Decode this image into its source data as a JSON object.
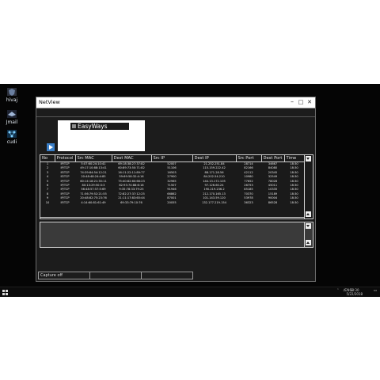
{
  "desktop": {
    "icons": [
      {
        "label": "hivaj",
        "icon": "shield-app-icon"
      },
      {
        "label": "Jmail",
        "icon": "hat-app-icon"
      },
      {
        "label": "cudi",
        "icon": "network-app-icon"
      }
    ]
  },
  "window": {
    "title": "NetView",
    "buttons": {
      "minimize": "–",
      "maximize": "□",
      "close": "✕"
    }
  },
  "logo": {
    "text": "EasyWays"
  },
  "table": {
    "columns": [
      "No",
      "Protocol",
      "Src MAC",
      "Dest MAC",
      "Src IP",
      "Dest IP",
      "Src Port",
      "Dest Port",
      "Time"
    ],
    "rows": [
      [
        "1",
        "IP/TCP",
        "5:07:60:24:10:41",
        "69:18:38:27:37:82",
        "52007",
        "21.252.251.84",
        "28714",
        "34667",
        "18:30"
      ],
      [
        "2",
        "IP/TCP",
        "49:17:10:88:13:41",
        "60:89:73:50:71:82",
        "51106",
        "115.159.222.42",
        "82166",
        "84080",
        "18:30"
      ],
      [
        "3",
        "IP/TCP",
        "74:39:84:54:12:21",
        "16:11:22:11:89:77",
        "16503",
        "88.171.28.56",
        "42112",
        "20345",
        "18:30"
      ],
      [
        "4",
        "IP/TCP",
        "20:48:48:24:4:85",
        "59:69:58:32:4:16",
        "27900",
        "84.202.54.210",
        "10980",
        "32549",
        "18:30"
      ],
      [
        "5",
        "IP/TCP",
        "60:14:18:21:35:11",
        "75:40:82:60:66:23",
        "32965",
        "144.13.172.105",
        "77652",
        "78028",
        "18:30"
      ],
      [
        "6",
        "IP/TCP",
        "80:13:29:50:3:3",
        "82:93:74:88:6:18",
        "71507",
        "97.126.60.24",
        "26753",
        "45011",
        "18:30"
      ],
      [
        "7",
        "IP/TCP",
        "56:48:57:57:5:69",
        "9:35:78:33:79:25",
        "91946",
        "190.219.236.2",
        "85185",
        "10335",
        "18:30"
      ],
      [
        "8",
        "IP/TCP",
        "71:56:79:52:21:55",
        "72:82:27:37:12:25",
        "66862",
        "212.170.165.13",
        "70370",
        "15189",
        "18:30"
      ],
      [
        "9",
        "IP/TCP",
        "20:48:82:75:23:76",
        "21:11:17:83:65:44",
        "87001",
        "101.143.59.120",
        "53978",
        "90004",
        "18:30"
      ],
      [
        "10",
        "IP/TCP",
        "4:14:60:81:61:49",
        "69:33:79:10:76",
        "20055",
        "132.177.219.154",
        "36323",
        "86528",
        "18:30"
      ]
    ]
  },
  "status": {
    "capture": "Capture off",
    "cell2": "",
    "cell3": ""
  },
  "taskbar": {
    "time": "18:30",
    "date": "5/22/2018",
    "lang": "ENG"
  }
}
